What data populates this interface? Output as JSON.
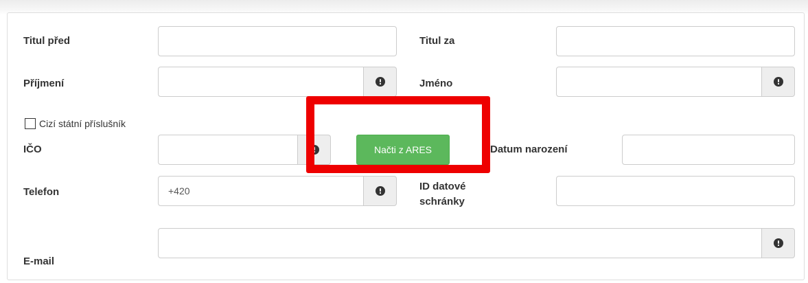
{
  "form": {
    "titul_pred": {
      "label": "Titul před",
      "value": ""
    },
    "titul_za": {
      "label": "Titul za",
      "value": ""
    },
    "prijmeni": {
      "label": "Příjmení",
      "value": ""
    },
    "jmeno": {
      "label": "Jméno",
      "value": ""
    },
    "cizi_statni_prislusnik": {
      "label": "Cizí státní příslušník",
      "checked": false
    },
    "ico": {
      "label": "IČO",
      "value": ""
    },
    "nacti_ares": {
      "label": "Načti z ARES"
    },
    "datum_narozeni": {
      "label": "Datum narození",
      "value": ""
    },
    "telefon": {
      "label": "Telefon",
      "value": "+420"
    },
    "id_datove_schranky": {
      "label_line1": "ID datové",
      "label_line2": "schránky",
      "value": ""
    },
    "email": {
      "label": "E-mail",
      "value": ""
    }
  },
  "icons": {
    "info": "info-circle-icon"
  },
  "colors": {
    "button_green": "#5cb85c",
    "highlight_red": "#ee0000",
    "addon_bg": "#eeeeee"
  }
}
